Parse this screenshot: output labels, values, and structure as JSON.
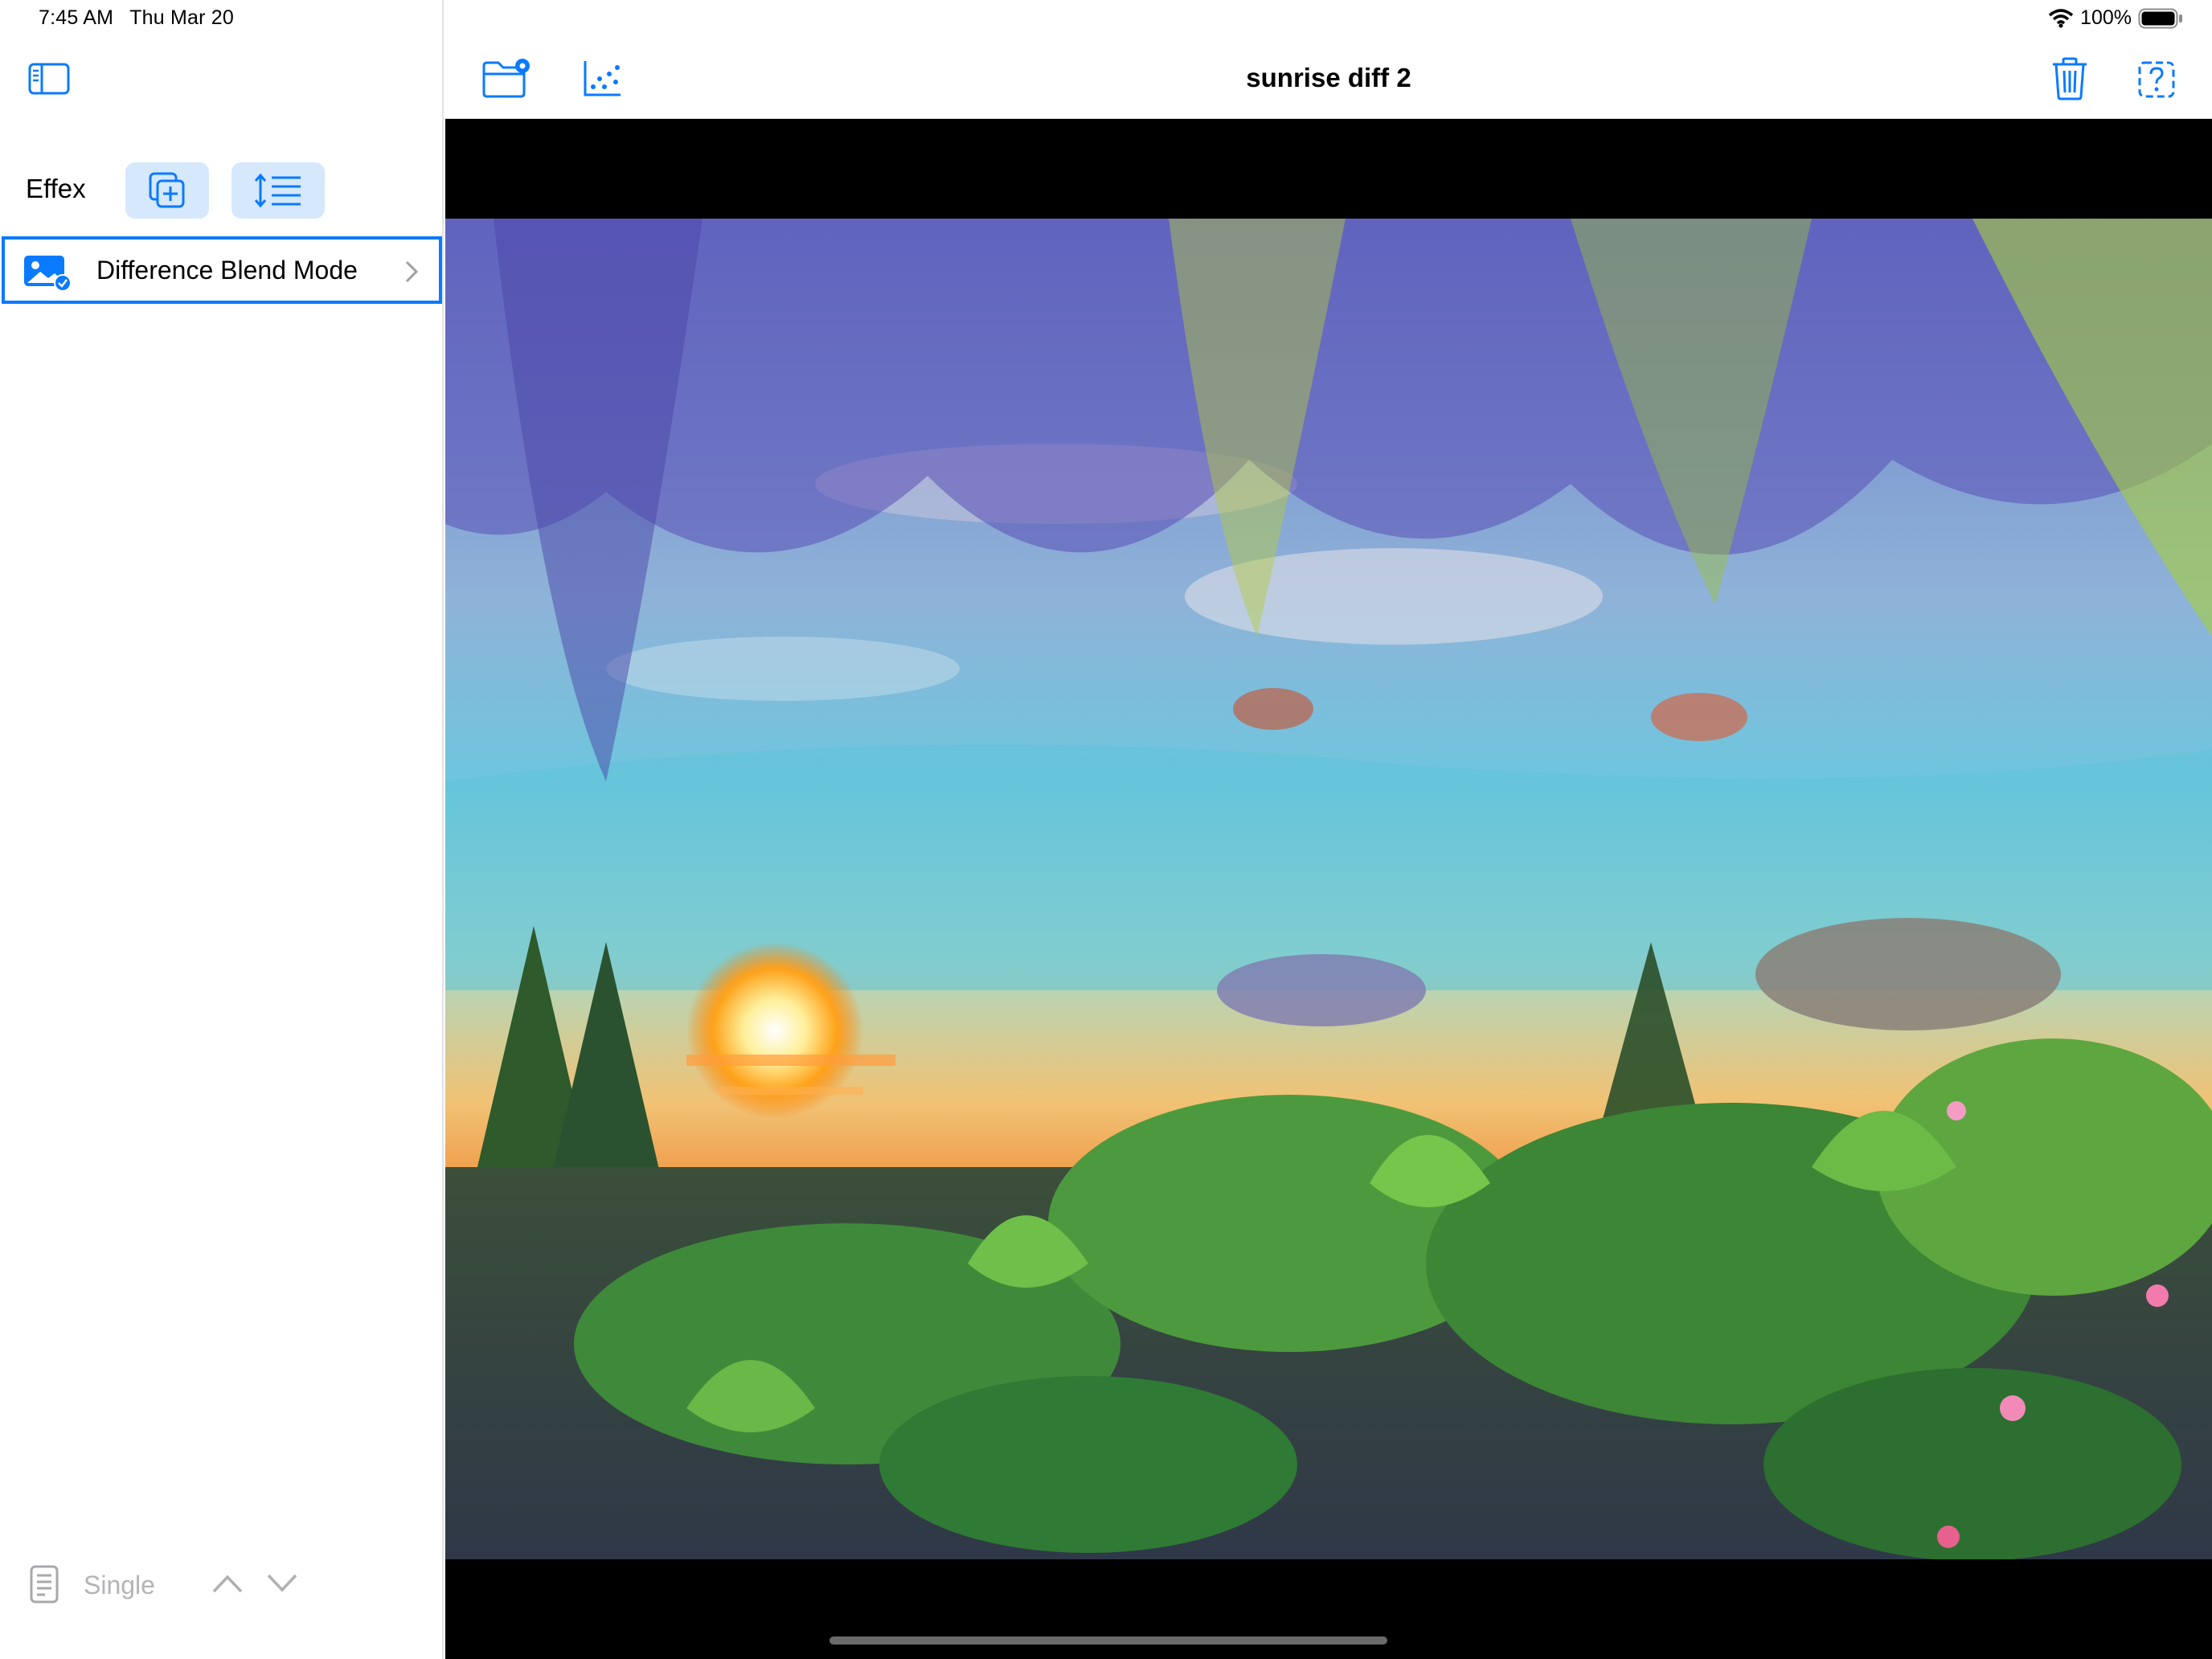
{
  "status_bar": {
    "time": "7:45 AM",
    "date": "Thu Mar 20",
    "battery": "100%"
  },
  "sidebar": {
    "section_label": "Effex",
    "effects": [
      {
        "label": "Difference Blend Mode",
        "selected": true,
        "icon": "photo-checkmark-icon"
      }
    ],
    "mode_label": "Single"
  },
  "toolbar": {
    "title": "sunrise diff 2",
    "left_icons": [
      "folder-gear-icon",
      "scatter-plot-icon"
    ],
    "right_icons": [
      "trash-icon",
      "help-icon"
    ]
  },
  "colors": {
    "accent": "#0a7aff",
    "pill_bg": "#d6e8fb",
    "canvas_bg": "#000000"
  }
}
